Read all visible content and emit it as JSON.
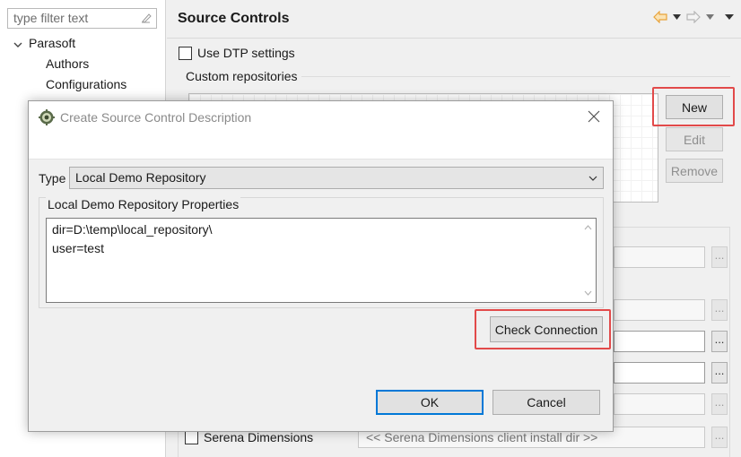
{
  "sidebar": {
    "filter_placeholder": "type filter text",
    "tree": [
      {
        "label": "Parasoft",
        "expanded": true
      },
      {
        "label": "Authors"
      },
      {
        "label": "Configurations"
      }
    ]
  },
  "page": {
    "title": "Source Controls",
    "use_dtp_label": "Use DTP settings",
    "custom_repos_label": "Custom repositories",
    "buttons": {
      "new": "New",
      "edit": "Edit",
      "remove": "Remove"
    },
    "serena_label": "Serena Dimensions",
    "serena_placeholder": "<< Serena Dimensions client install dir >>",
    "dots": "..."
  },
  "dialog": {
    "title": "Create Source Control Description",
    "type_label": "Type",
    "type_value": "Local Demo Repository",
    "props_label": "Local Demo Repository Properties",
    "props_lines": [
      "dir=D:\\temp\\local_repository\\",
      "user=test"
    ],
    "check_connection": "Check Connection",
    "ok": "OK",
    "cancel": "Cancel"
  },
  "colors": {
    "highlight": "#e24a4a",
    "default_button_border": "#0078d7",
    "nav_back_icon": "#e8a33a"
  }
}
